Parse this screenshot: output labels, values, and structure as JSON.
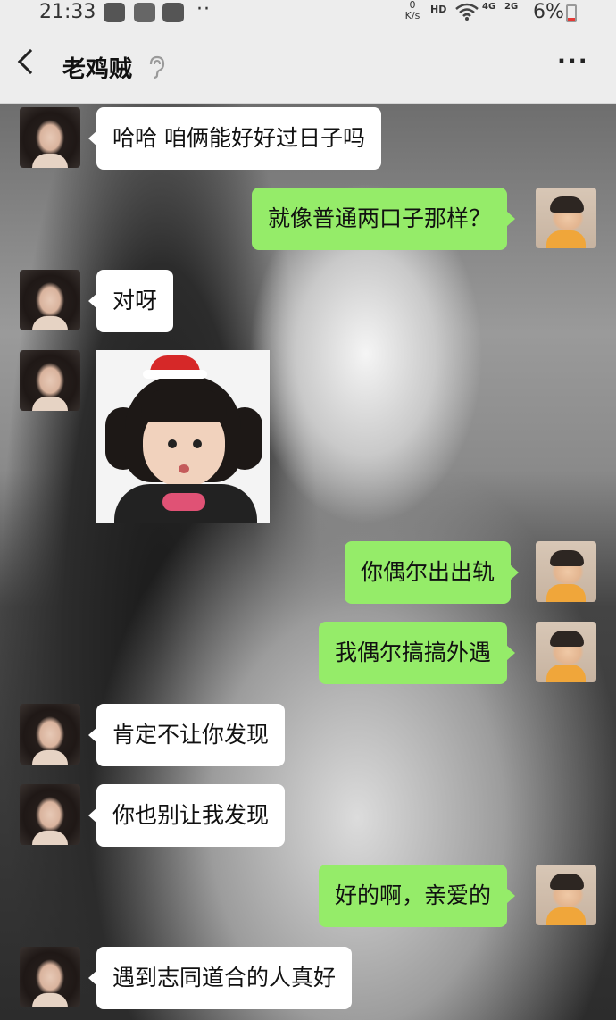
{
  "status_bar": {
    "time": "21:33",
    "net_speed_value": "0",
    "net_speed_unit": "K/s",
    "hd": "HD",
    "net_4g": "4G",
    "net_2g": "2G",
    "battery": "6%",
    "battery_color": "#e53935"
  },
  "header": {
    "title": "老鸡贼",
    "more": "···"
  },
  "messages": [
    {
      "side": "left",
      "text": "哈哈 咱俩能好好过日子吗"
    },
    {
      "side": "right",
      "text": "就像普通两口子那样？"
    },
    {
      "side": "left",
      "text": "对呀"
    },
    {
      "side": "left",
      "type": "sticker",
      "sticker": "girl-pout-sticker"
    },
    {
      "side": "right",
      "text": "你偶尔出出轨"
    },
    {
      "side": "right",
      "text": "我偶尔搞搞外遇"
    },
    {
      "side": "left",
      "text": "肯定不让你发现"
    },
    {
      "side": "left",
      "text": "你也别让我发现"
    },
    {
      "side": "right",
      "text": "好的啊，亲爱的"
    },
    {
      "side": "left",
      "text": "遇到志同道合的人真好"
    }
  ],
  "colors": {
    "right_bubble": "#95ec69",
    "left_bubble": "#ffffff",
    "header_bg": "#ededed"
  }
}
